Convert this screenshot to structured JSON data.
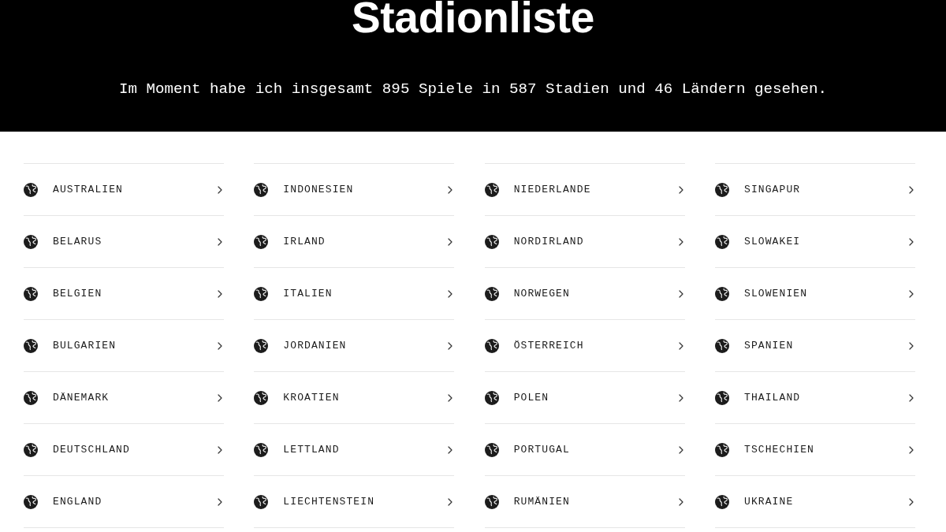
{
  "header": {
    "title": "Stadionliste",
    "intro": "Im Moment habe ich insgesamt 895 Spiele in 587 Stadien und 46 Ländern gesehen."
  },
  "columns": [
    {
      "countries": [
        "AUSTRALIEN",
        "BELARUS",
        "BELGIEN",
        "BULGARIEN",
        "DÄNEMARK",
        "DEUTSCHLAND",
        "ENGLAND"
      ]
    },
    {
      "countries": [
        "INDONESIEN",
        "IRLAND",
        "ITALIEN",
        "JORDANIEN",
        "KROATIEN",
        "LETTLAND",
        "LIECHTENSTEIN"
      ]
    },
    {
      "countries": [
        "NIEDERLANDE",
        "NORDIRLAND",
        "NORWEGEN",
        "ÖSTERREICH",
        "POLEN",
        "PORTUGAL",
        "RUMÄNIEN"
      ]
    },
    {
      "countries": [
        "SINGAPUR",
        "SLOWAKEI",
        "SLOWENIEN",
        "SPANIEN",
        "THAILAND",
        "TSCHECHIEN",
        "UKRAINE"
      ]
    }
  ]
}
